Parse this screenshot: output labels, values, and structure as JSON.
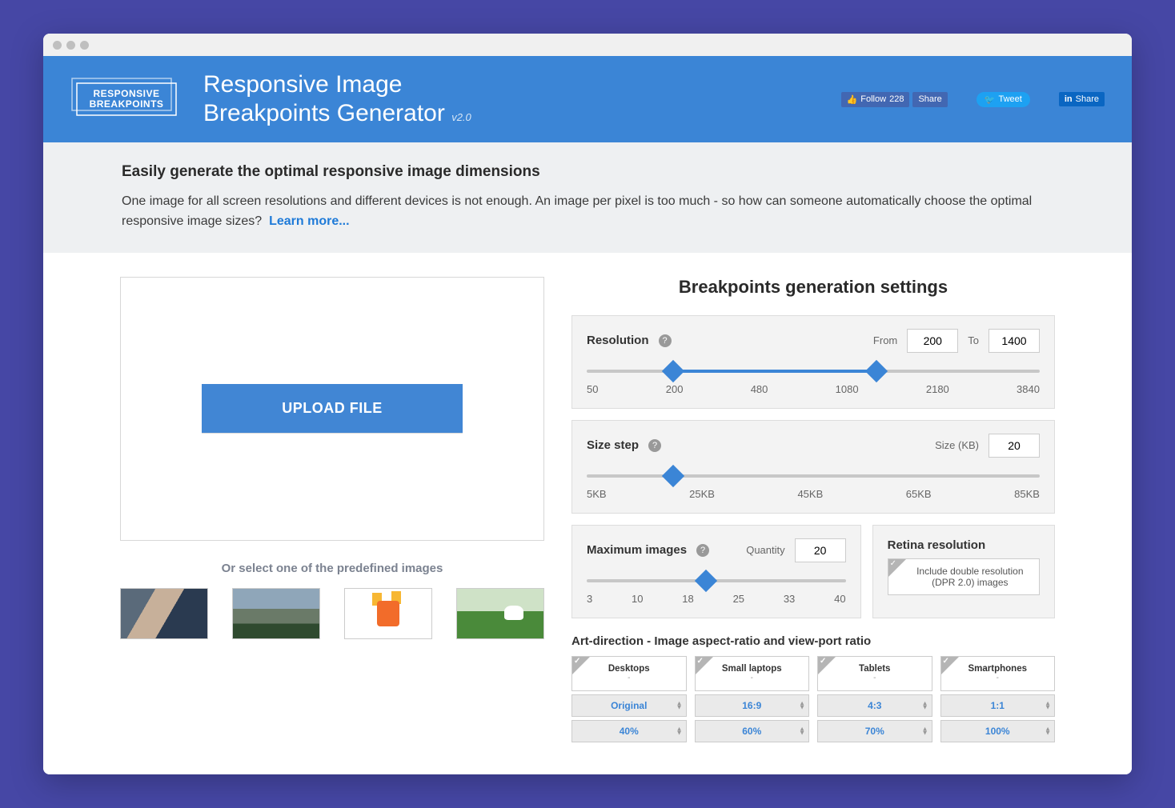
{
  "header": {
    "logo_line1": "RESPONSIVE",
    "logo_line2": "BREAKPOINTS",
    "title_line1": "Responsive Image",
    "title_line2": "Breakpoints Generator",
    "version": "v2.0",
    "fb_follow": "Follow",
    "fb_count": "228",
    "fb_share": "Share",
    "tw_label": "Tweet",
    "in_label": "Share"
  },
  "intro": {
    "headline": "Easily generate the optimal responsive image dimensions",
    "body": "One image for all screen resolutions and different devices is not enough. An image per pixel is too much - so how can someone automatically choose the optimal responsive image sizes?",
    "learn_more": "Learn more..."
  },
  "upload": {
    "button": "UPLOAD FILE",
    "or_text": "Or select one of the predefined images"
  },
  "settings_title": "Breakpoints generation settings",
  "resolution": {
    "label": "Resolution",
    "from_label": "From",
    "from_value": "200",
    "to_label": "To",
    "to_value": "1400",
    "ticks": [
      "50",
      "200",
      "480",
      "1080",
      "2180",
      "3840"
    ]
  },
  "sizestep": {
    "label": "Size step",
    "size_label": "Size (KB)",
    "value": "20",
    "ticks": [
      "5KB",
      "25KB",
      "45KB",
      "65KB",
      "85KB"
    ]
  },
  "maximages": {
    "label": "Maximum images",
    "qty_label": "Quantity",
    "value": "20",
    "ticks": [
      "3",
      "10",
      "18",
      "25",
      "33",
      "40"
    ]
  },
  "retina": {
    "title": "Retina resolution",
    "text": "Include double resolution (DPR 2.0) images"
  },
  "art": {
    "title": "Art-direction - Image aspect-ratio and view-port ratio",
    "cols": [
      {
        "name": "Desktops",
        "sub": "-",
        "aspect": "Original",
        "vp": "40%"
      },
      {
        "name": "Small laptops",
        "sub": "-",
        "aspect": "16:9",
        "vp": "60%"
      },
      {
        "name": "Tablets",
        "sub": "-",
        "aspect": "4:3",
        "vp": "70%"
      },
      {
        "name": "Smartphones",
        "sub": "-",
        "aspect": "1:1",
        "vp": "100%"
      }
    ]
  }
}
